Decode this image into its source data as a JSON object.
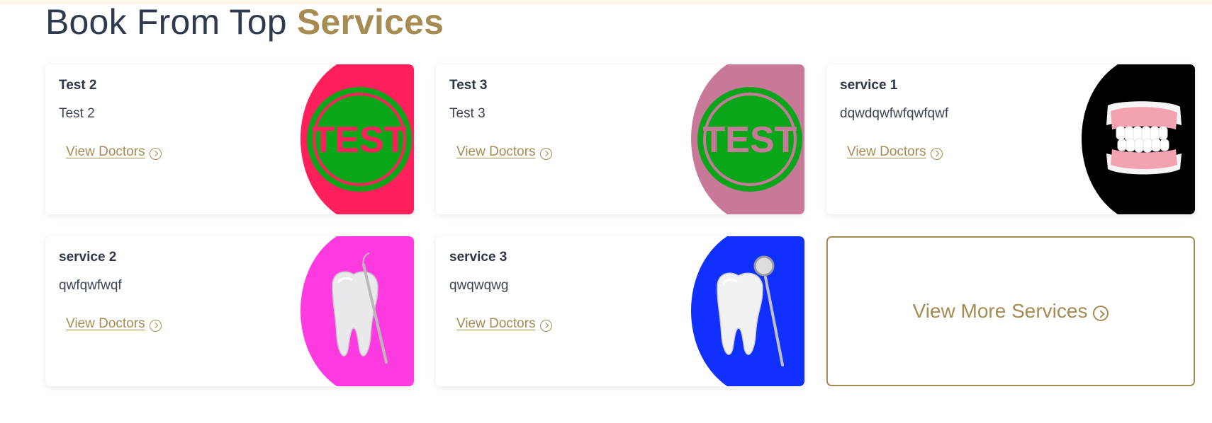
{
  "heading": {
    "prefix": "Book From Top",
    "accent": "Services"
  },
  "link_label": "View Doctors",
  "services": [
    {
      "title": "Test 2",
      "description": "Test 2",
      "image": "test-stamp-icon",
      "bg_color": "#ff1f5a"
    },
    {
      "title": "Test 3",
      "description": "Test 3",
      "image": "test-stamp-icon",
      "bg_color": "#c8799a"
    },
    {
      "title": "service 1",
      "description": "dqwdqwfwfqwfqwf",
      "image": "dentures-icon",
      "bg_color": "#000000"
    },
    {
      "title": "service 2",
      "description": "qwfqwfwqf",
      "image": "tooth-with-probe-icon",
      "bg_color": "#ff3ae0"
    },
    {
      "title": "service 3",
      "description": "qwqwqwg",
      "image": "tooth-with-mirror-icon",
      "bg_color": "#1030ff"
    }
  ],
  "more_services": {
    "label": "View More Services"
  },
  "colors": {
    "accent": "#a68b52",
    "heading": "#303a4f",
    "stamp_green": "#0aa619"
  }
}
